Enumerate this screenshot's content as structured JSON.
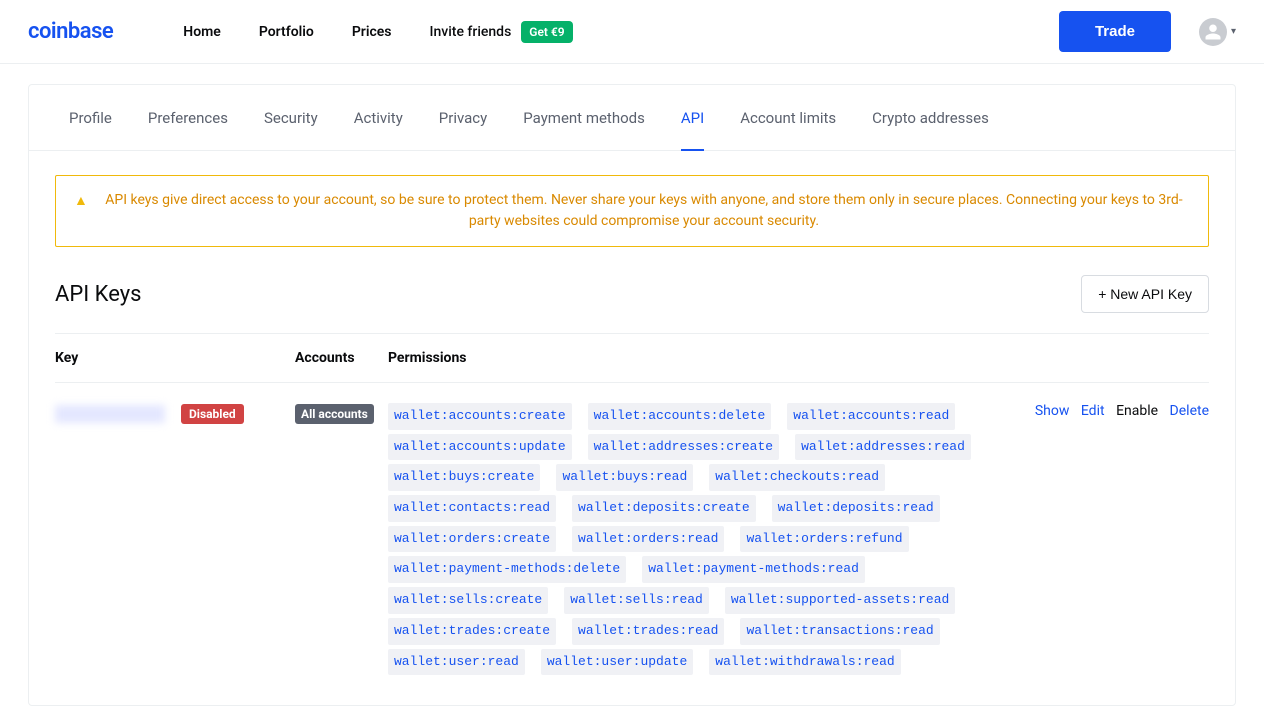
{
  "brand": "coinbase",
  "nav": {
    "links": [
      "Home",
      "Portfolio",
      "Prices"
    ],
    "invite": "Invite friends",
    "invite_badge": "Get €9",
    "trade": "Trade"
  },
  "tabs": [
    "Profile",
    "Preferences",
    "Security",
    "Activity",
    "Privacy",
    "Payment methods",
    "API",
    "Account limits",
    "Crypto addresses"
  ],
  "active_tab": "API",
  "warning": "API keys give direct access to your account, so be sure to protect them. Never share your keys with anyone, and store them only in secure places. Connecting your keys to 3rd-party websites could compromise your account security.",
  "section": {
    "title": "API Keys",
    "new_button": "+  New API Key"
  },
  "columns": {
    "key": "Key",
    "accounts": "Accounts",
    "permissions": "Permissions"
  },
  "row": {
    "disabled_label": "Disabled",
    "accounts_label": "All accounts",
    "permissions": [
      "wallet:accounts:create",
      "wallet:accounts:delete",
      "wallet:accounts:read",
      "wallet:accounts:update",
      "wallet:addresses:create",
      "wallet:addresses:read",
      "wallet:buys:create",
      "wallet:buys:read",
      "wallet:checkouts:read",
      "wallet:contacts:read",
      "wallet:deposits:create",
      "wallet:deposits:read",
      "wallet:orders:create",
      "wallet:orders:read",
      "wallet:orders:refund",
      "wallet:payment-methods:delete",
      "wallet:payment-methods:read",
      "wallet:sells:create",
      "wallet:sells:read",
      "wallet:supported-assets:read",
      "wallet:trades:create",
      "wallet:trades:read",
      "wallet:transactions:read",
      "wallet:user:read",
      "wallet:user:update",
      "wallet:withdrawals:read"
    ],
    "actions": {
      "show": "Show",
      "edit": "Edit",
      "enable": "Enable",
      "delete": "Delete"
    }
  }
}
